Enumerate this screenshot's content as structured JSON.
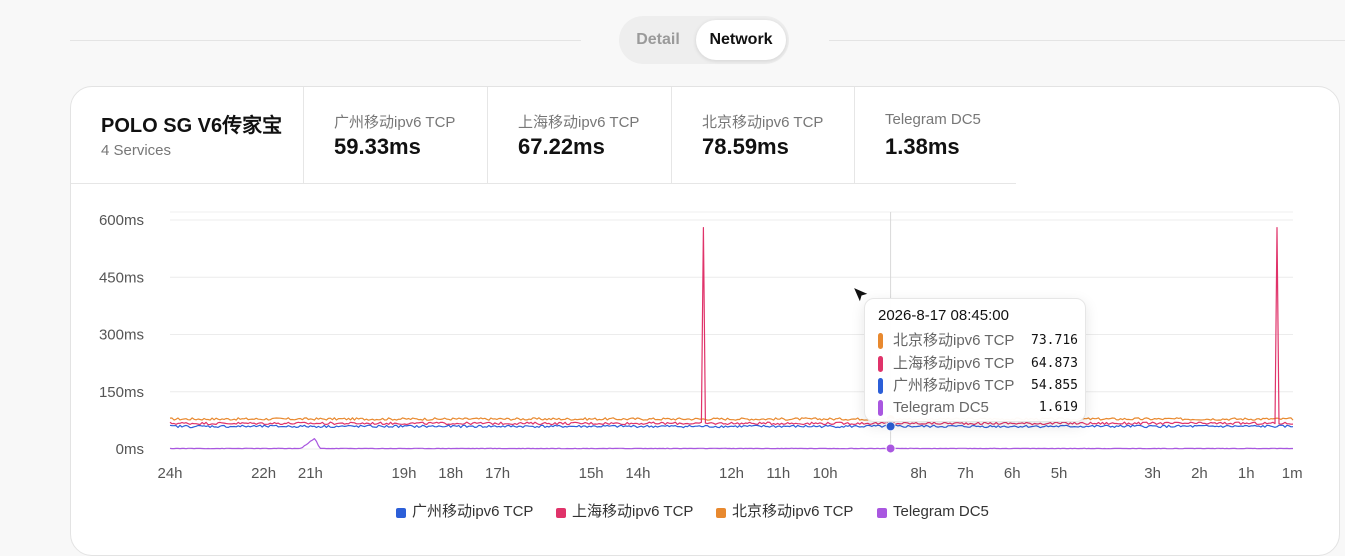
{
  "tabs": [
    {
      "label": "Detail",
      "active": false
    },
    {
      "label": "Network",
      "active": true
    }
  ],
  "server": {
    "name": "POLO SG V6传家宝",
    "services": "4 Services"
  },
  "stats": [
    {
      "label": "广州移动ipv6 TCP",
      "value": "59.33ms"
    },
    {
      "label": "上海移动ipv6 TCP",
      "value": "67.22ms"
    },
    {
      "label": "北京移动ipv6 TCP",
      "value": "78.59ms"
    },
    {
      "label": "Telegram DC5",
      "value": "1.38ms"
    }
  ],
  "tooltip": {
    "time": "2026-8-17 08:45:00",
    "rows": [
      {
        "name": "北京移动ipv6 TCP",
        "value": "73.716",
        "color": "#e8892f"
      },
      {
        "name": "上海移动ipv6 TCP",
        "value": "64.873",
        "color": "#e0336a"
      },
      {
        "name": "广州移动ipv6 TCP",
        "value": "54.855",
        "color": "#2c5fd8"
      },
      {
        "name": "Telegram DC5",
        "value": "1.619",
        "color": "#a957e0"
      }
    ]
  },
  "legend": [
    {
      "label": "广州移动ipv6 TCP",
      "color": "#2c5fd8"
    },
    {
      "label": "上海移动ipv6 TCP",
      "color": "#e0336a"
    },
    {
      "label": "北京移动ipv6 TCP",
      "color": "#e8892f"
    },
    {
      "label": "Telegram DC5",
      "color": "#a957e0"
    }
  ],
  "chart_data": {
    "type": "line",
    "x_unit": "hours ago",
    "xlim": [
      24,
      0
    ],
    "ylim": [
      0,
      600
    ],
    "y_ticks": [
      "600ms",
      "450ms",
      "300ms",
      "150ms",
      "0ms"
    ],
    "y_tick_values": [
      600,
      450,
      300,
      150,
      0
    ],
    "x_ticks": [
      "24h",
      "22h",
      "21h",
      "19h",
      "18h",
      "17h",
      "15h",
      "14h",
      "12h",
      "11h",
      "10h",
      "8h",
      "7h",
      "6h",
      "5h",
      "3h",
      "2h",
      "1h",
      "1m"
    ],
    "x_tick_values": [
      24,
      22,
      21,
      19,
      18,
      17,
      15,
      14,
      12,
      11,
      10,
      8,
      7,
      6,
      5,
      3,
      2,
      1,
      0.017
    ],
    "cursor_x": 8.6,
    "series": [
      {
        "name": "北京移动ipv6 TCP",
        "color": "#e8892f",
        "x": [
          24,
          0
        ],
        "values": [
          78.6,
          78.6
        ],
        "spikes": []
      },
      {
        "name": "上海移动ipv6 TCP",
        "color": "#e0336a",
        "x": [
          24,
          0
        ],
        "values": [
          67.2,
          67.2
        ],
        "spikes": [
          {
            "x": 12.6,
            "value": 580
          },
          {
            "x": 0.35,
            "value": 580
          }
        ]
      },
      {
        "name": "广州移动ipv6 TCP",
        "color": "#2c5fd8",
        "x": [
          24,
          0
        ],
        "values": [
          59.3,
          59.3
        ],
        "spikes": []
      },
      {
        "name": "Telegram DC5",
        "color": "#a957e0",
        "x": [
          24,
          21.2,
          21.0,
          20.9,
          20.8,
          0
        ],
        "values": [
          1.4,
          1.4,
          20,
          28,
          1.4,
          1.4
        ],
        "spikes": []
      }
    ],
    "grid": true,
    "legend_position": "bottom-center"
  }
}
